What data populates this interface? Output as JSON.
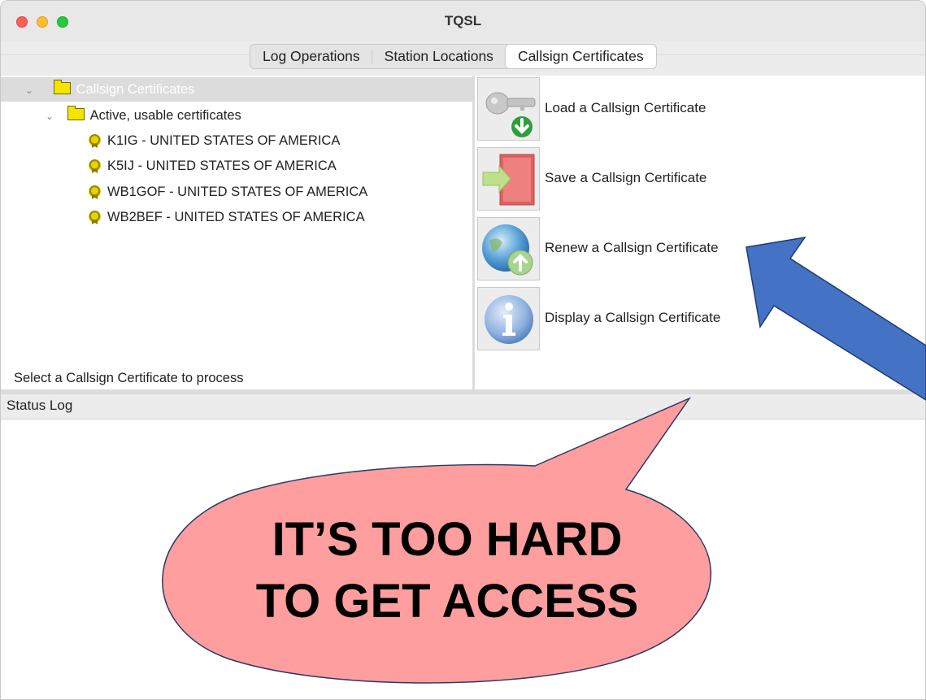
{
  "window": {
    "title": "TQSL"
  },
  "tabs": [
    {
      "label": "Log Operations",
      "active": false
    },
    {
      "label": "Station Locations",
      "active": false
    },
    {
      "label": "Callsign Certificates",
      "active": true
    }
  ],
  "tree": {
    "root": {
      "label": "Callsign Certificates",
      "icon": "folder-icon"
    },
    "group": {
      "label": "Active, usable certificates",
      "icon": "folder-icon"
    },
    "certificates": [
      {
        "label": "K1IG - UNITED STATES OF AMERICA",
        "icon": "certificate-icon"
      },
      {
        "label": "K5IJ - UNITED STATES OF AMERICA",
        "icon": "certificate-icon"
      },
      {
        "label": "WB1GOF - UNITED STATES OF AMERICA",
        "icon": "certificate-icon"
      },
      {
        "label": "WB2BEF - UNITED STATES OF AMERICA",
        "icon": "certificate-icon"
      }
    ],
    "status_text": "Select a Callsign Certificate to process"
  },
  "actions": [
    {
      "label": "Load a Callsign Certificate",
      "icon": "key-download-icon"
    },
    {
      "label": "Save a Callsign Certificate",
      "icon": "door-save-icon"
    },
    {
      "label": "Renew a Callsign Certificate",
      "icon": "globe-upload-icon"
    },
    {
      "label": "Display a Callsign Certificate",
      "icon": "info-icon"
    }
  ],
  "status_log": {
    "title": "Status Log",
    "content": ""
  },
  "annotation": {
    "bubble_line1": "IT’S TOO HARD",
    "bubble_line2": "TO GET ACCESS",
    "bubble_color": "#fe9e9e",
    "arrow_color": "#4472c4",
    "arrow_points_to": "Renew a Callsign Certificate"
  }
}
